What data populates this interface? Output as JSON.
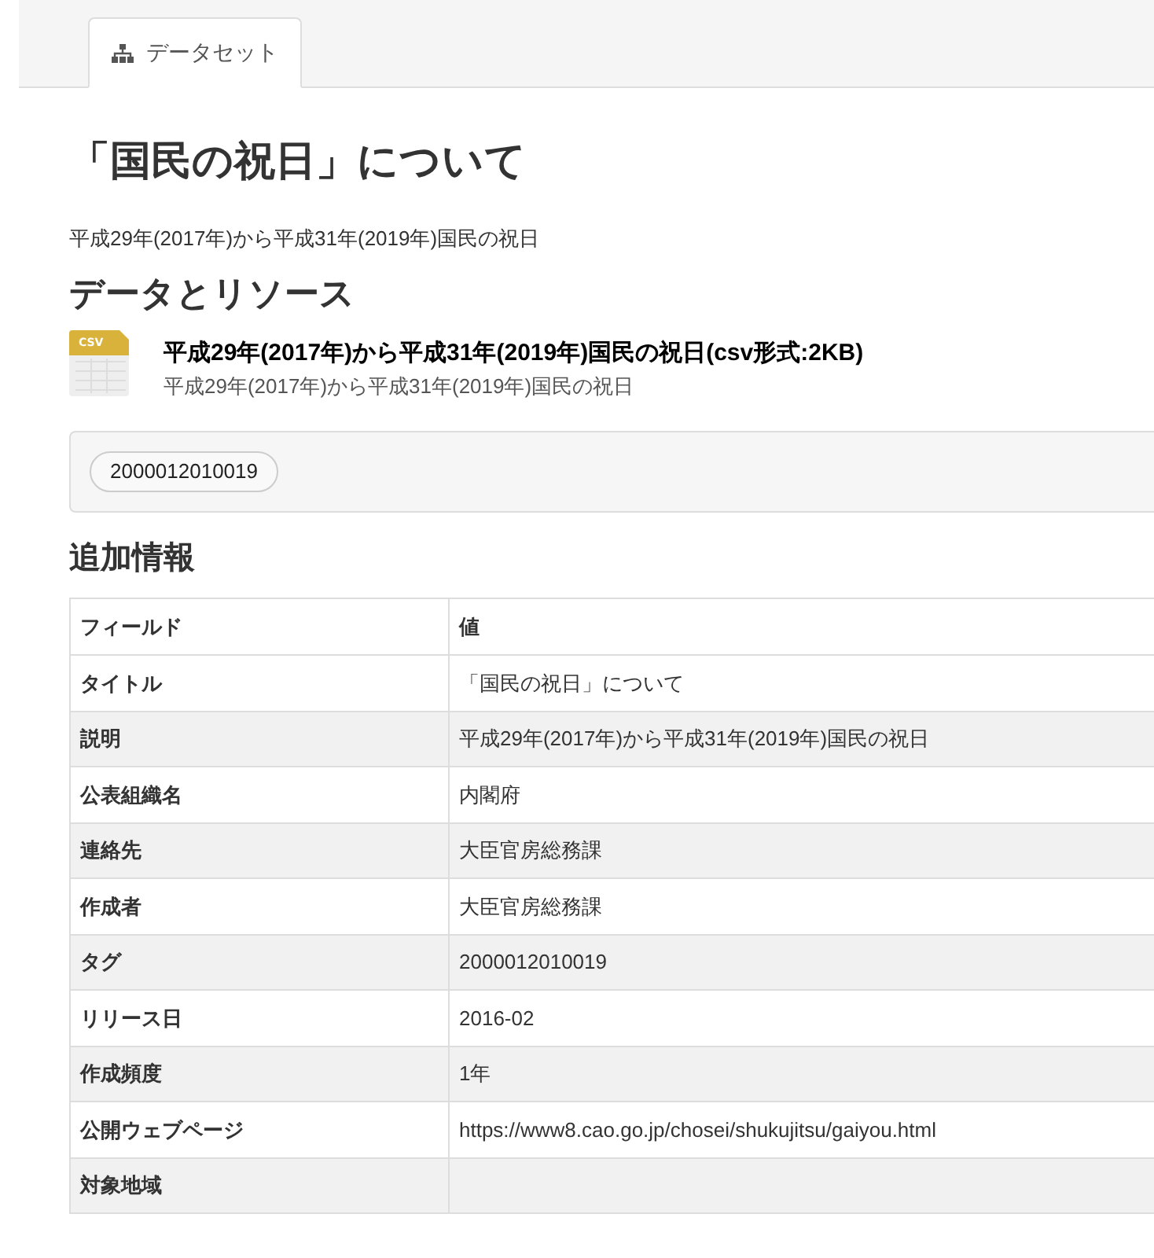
{
  "tabs": [
    {
      "label": "データセット",
      "selected": true
    }
  ],
  "title": "「国民の祝日」について",
  "description": "平成29年(2017年)から平成31年(2019年)国民の祝日",
  "resources": {
    "heading": "データとリソース",
    "items": [
      {
        "format": "CSV",
        "name": "平成29年(2017年)から平成31年(2019年)国民の祝日(csv形式:2KB)",
        "description": "平成29年(2017年)から平成31年(2019年)国民の祝日"
      }
    ]
  },
  "tags": [
    "2000012010019"
  ],
  "additional_info": {
    "heading": "追加情報",
    "columns": [
      "フィールド",
      "値"
    ],
    "rows": [
      [
        "タイトル",
        "「国民の祝日」について"
      ],
      [
        "説明",
        "平成29年(2017年)から平成31年(2019年)国民の祝日"
      ],
      [
        "公表組織名",
        "内閣府"
      ],
      [
        "連絡先",
        "大臣官房総務課"
      ],
      [
        "作成者",
        "大臣官房総務課"
      ],
      [
        "タグ",
        "2000012010019"
      ],
      [
        "リリース日",
        "2016-02"
      ],
      [
        "作成頻度",
        "1年"
      ],
      [
        "公開ウェブページ",
        "https://www8.cao.go.jp/chosei/shukujitsu/gaiyou.html"
      ],
      [
        "対象地域",
        ""
      ]
    ]
  }
}
